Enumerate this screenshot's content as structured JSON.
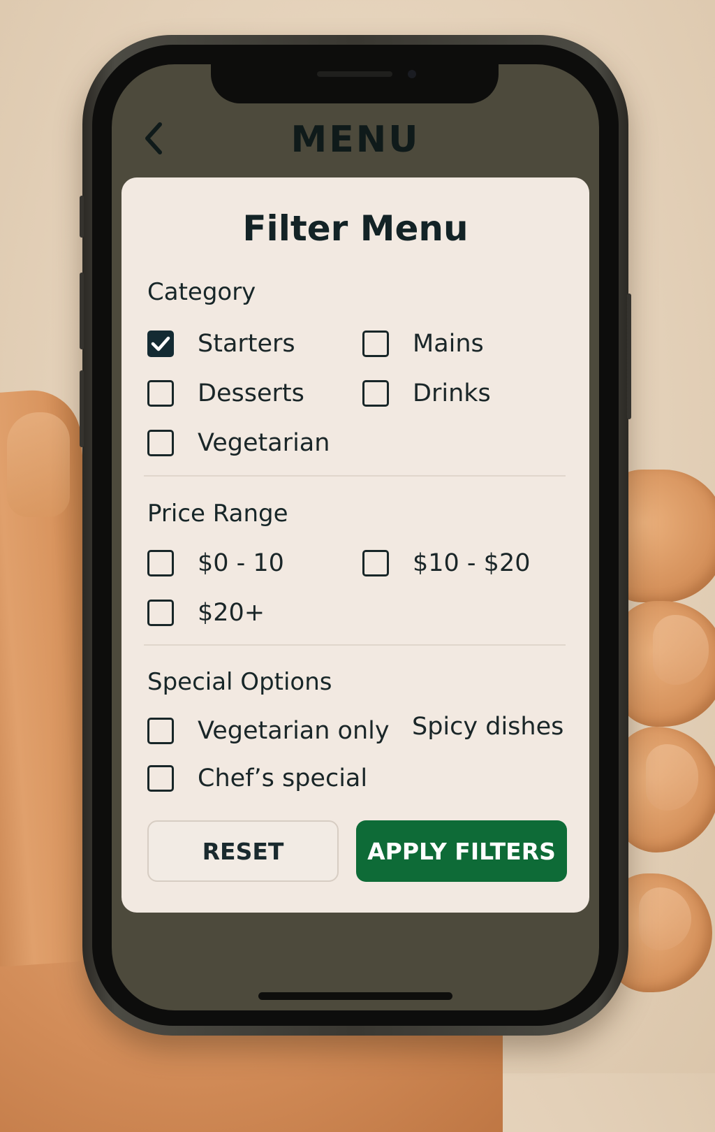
{
  "header": {
    "title": "MENU",
    "back_icon": "chevron-left-icon"
  },
  "filter": {
    "title": "Filter Menu",
    "category": {
      "heading": "Category",
      "options": [
        {
          "label": "Starters",
          "checked": true
        },
        {
          "label": "Mains",
          "checked": false
        },
        {
          "label": "Desserts",
          "checked": false
        },
        {
          "label": "Drinks",
          "checked": false
        },
        {
          "label": "Vegetarian",
          "checked": false
        }
      ]
    },
    "price_range": {
      "heading": "Price Range",
      "options": [
        {
          "label": "$0 - 10",
          "checked": false
        },
        {
          "label": "$10 - $20",
          "checked": false
        },
        {
          "label": "$20+",
          "checked": false
        }
      ]
    },
    "special_options": {
      "heading": "Special Options",
      "options": [
        {
          "label": "Vegetarian only",
          "checked": false
        },
        {
          "label": "Spicy dishes",
          "checked": false
        },
        {
          "label": "Chef’s special",
          "checked": false
        }
      ]
    },
    "buttons": {
      "reset_label": "RESET",
      "apply_label": "APPLY FILTERS"
    }
  },
  "colors": {
    "screen_background": "#4d4a3c",
    "card_background": "#f2e9e1",
    "accent_green": "#0e6b37",
    "checkbox_checked": "#142b33",
    "text_dark": "#132326"
  }
}
